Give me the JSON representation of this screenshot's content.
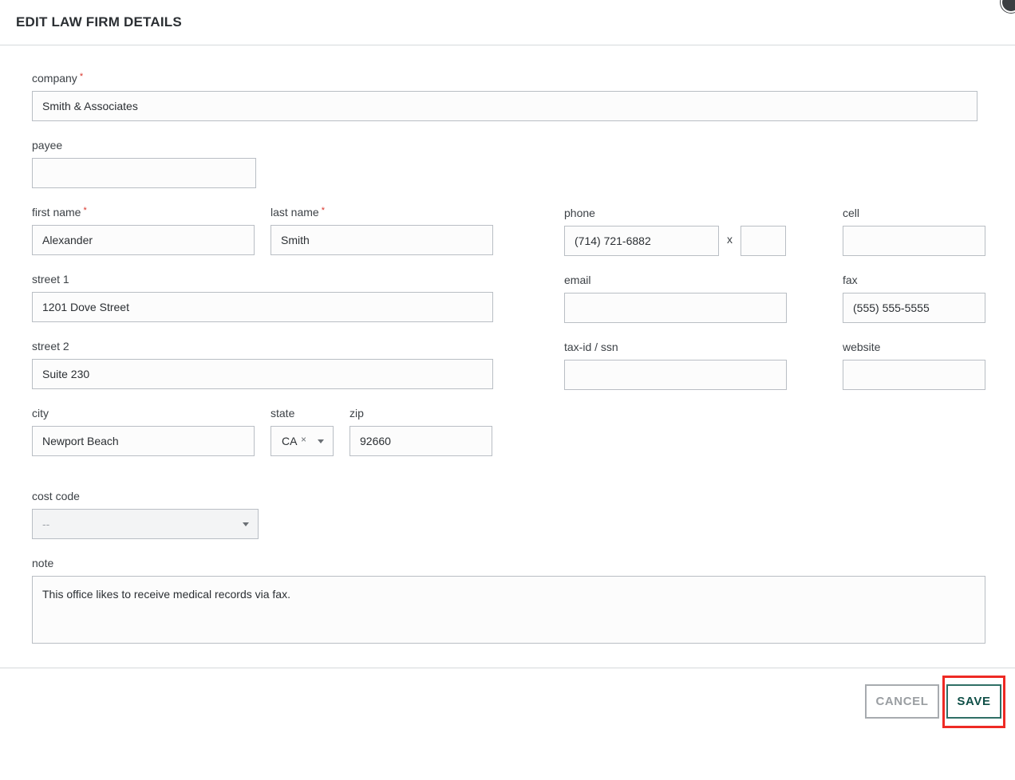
{
  "dialog": {
    "title": "EDIT LAW FIRM DETAILS"
  },
  "fields": {
    "company": {
      "label": "company",
      "required": "*",
      "value": "Smith & Associates"
    },
    "payee": {
      "label": "payee",
      "value": ""
    },
    "first_name": {
      "label": "first name",
      "required": "*",
      "value": "Alexander"
    },
    "last_name": {
      "label": "last name",
      "required": "*",
      "value": "Smith"
    },
    "street1": {
      "label": "street 1",
      "value": "1201 Dove Street"
    },
    "street2": {
      "label": "street 2",
      "value": "Suite 230"
    },
    "city": {
      "label": "city",
      "value": "Newport Beach"
    },
    "state": {
      "label": "state",
      "value": "CA",
      "clear": "×"
    },
    "zip": {
      "label": "zip",
      "value": "92660"
    },
    "phone": {
      "label": "phone",
      "value": "(714) 721-6882",
      "ext_sep": "x",
      "ext": ""
    },
    "cell": {
      "label": "cell",
      "value": ""
    },
    "email": {
      "label": "email",
      "value": ""
    },
    "fax": {
      "label": "fax",
      "value": "(555) 555-5555"
    },
    "tax_id": {
      "label": "tax-id / ssn",
      "value": ""
    },
    "website": {
      "label": "website",
      "value": ""
    },
    "cost_code": {
      "label": "cost code",
      "value": "--"
    },
    "note": {
      "label": "note",
      "value": "This office likes to receive medical records via fax."
    }
  },
  "footer": {
    "cancel_label": "CANCEL",
    "save_label": "SAVE"
  },
  "colors": {
    "primary": "#0f4f47",
    "required": "#d9342b",
    "highlight": "#ee2a24"
  }
}
